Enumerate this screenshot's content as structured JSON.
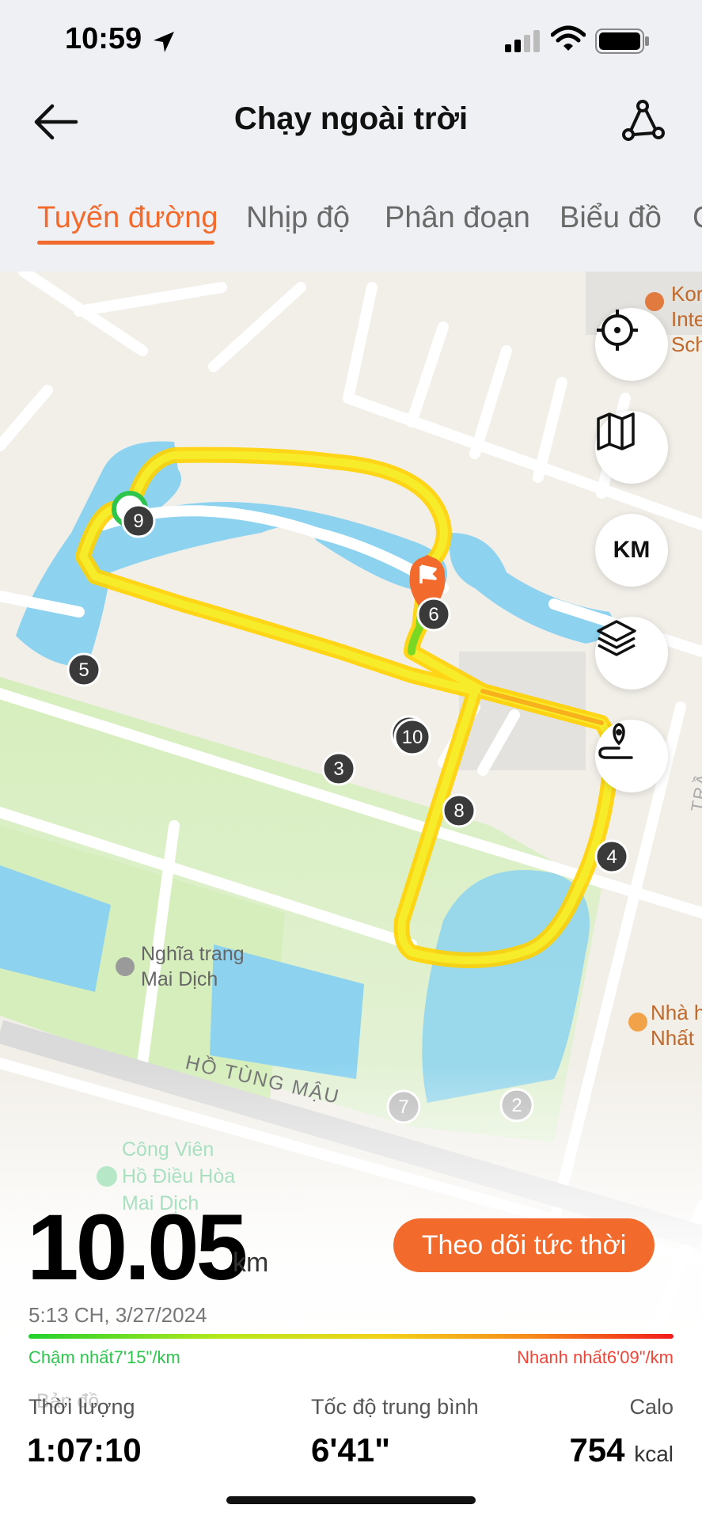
{
  "status_bar": {
    "time": "10:59"
  },
  "header": {
    "title": "Chạy ngoài trời"
  },
  "tabs": [
    {
      "label": "Tuyến đường",
      "active": true
    },
    {
      "label": "Nhịp độ",
      "active": false
    },
    {
      "label": "Phân đoạn",
      "active": false
    },
    {
      "label": "Biểu đồ",
      "active": false
    }
  ],
  "map": {
    "controls": {
      "units_label": "KM"
    },
    "markers": [
      "2",
      "3",
      "4",
      "5",
      "6",
      "7",
      "8",
      "9",
      "10"
    ],
    "poi": {
      "school": "Kor\nInte\nSch",
      "restaurant": "Nhà h\nNhất"
    },
    "places": {
      "cemetery": "Nghĩa trang\nMai Dịch",
      "park": "Công Viên\nHồ Điều Hòa\nMai Dịch"
    },
    "streets": {
      "ho_tung_mau": "HỒ TÙNG MẬU",
      "tran": "TRẦ"
    },
    "watermark": "Bản đồ"
  },
  "summary": {
    "distance": "10.05",
    "distance_unit": "km",
    "live_button": "Theo dõi tức thời",
    "datetime": "5:13 CH, 3/27/2024",
    "slowest": "Chậm nhất7'15\"/km",
    "fastest": "Nhanh nhất6'09\"/km"
  },
  "metrics": {
    "duration": {
      "label": "Thời lượng",
      "value": "1:07:10"
    },
    "avg_pace": {
      "label": "Tốc độ trung bình",
      "value": "6'41\""
    },
    "calories": {
      "label": "Calo",
      "value": "754",
      "unit": "kcal"
    }
  },
  "colors": {
    "accent": "#f26a2c",
    "slow": "#2ec54d",
    "fast": "#f04437",
    "water": "#8dd3f0",
    "park": "#d6eebc"
  }
}
